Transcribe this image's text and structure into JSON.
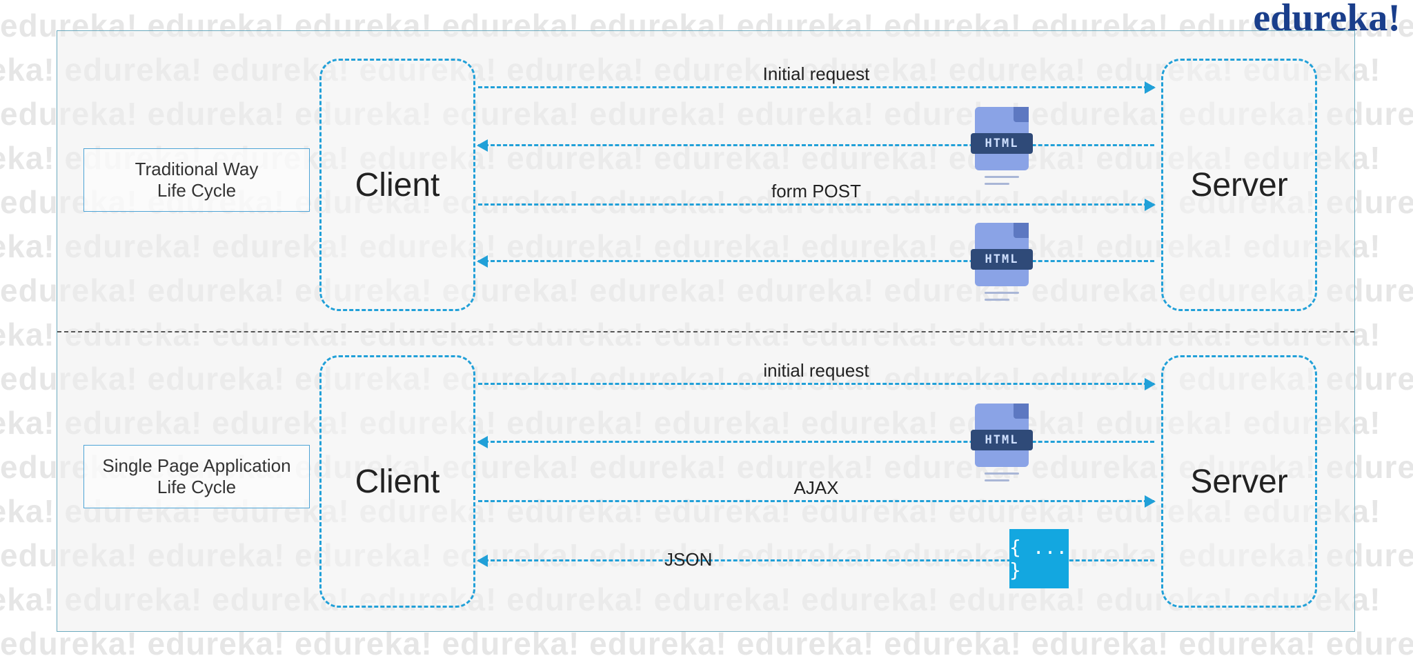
{
  "brand": "edureka!",
  "watermark_word": "edureka!",
  "sections": {
    "top": {
      "title_l1": "Traditional Way",
      "title_l2": "Life Cycle",
      "client": "Client",
      "server": "Server",
      "arrows": {
        "a1": "Initial request",
        "a2_badge": "HTML",
        "a3": "form POST",
        "a4_badge": "HTML"
      }
    },
    "bottom": {
      "title_l1": "Single Page Application",
      "title_l2": "Life Cycle",
      "client": "Client",
      "server": "Server",
      "arrows": {
        "b1": "initial request",
        "b2_badge": "HTML",
        "b3": "AJAX",
        "b4_label": "JSON",
        "b4_icon": "{ ... }"
      }
    }
  }
}
